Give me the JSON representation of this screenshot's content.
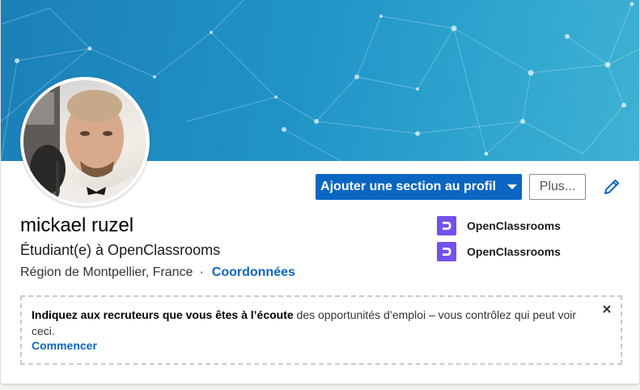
{
  "profile": {
    "name": "mickael ruzel",
    "headline": "Étudiant(e) à OpenClassrooms",
    "location": "Région de Montpellier, France",
    "separator": "·",
    "contact_link": "Coordonnées"
  },
  "actions": {
    "add_section_label": "Ajouter une section au profil",
    "more_label": "Plus..."
  },
  "organizations": [
    {
      "name": "OpenClassrooms"
    },
    {
      "name": "OpenClassrooms"
    }
  ],
  "notice": {
    "bold_text": "Indiquez aux recruteurs que vous êtes à l’écoute",
    "text": " des opportunités d’emploi – vous contrôlez qui peut voir ceci.",
    "link": "Commencer"
  },
  "colors": {
    "primary": "#0a66c2",
    "openclassrooms_brand": "#7451eb",
    "banner": "#1f93c7"
  },
  "icons": {
    "dropdown": "caret-down-icon",
    "edit": "pencil-icon",
    "close": "close-icon",
    "org_logo": "openclassrooms-logo-icon"
  }
}
